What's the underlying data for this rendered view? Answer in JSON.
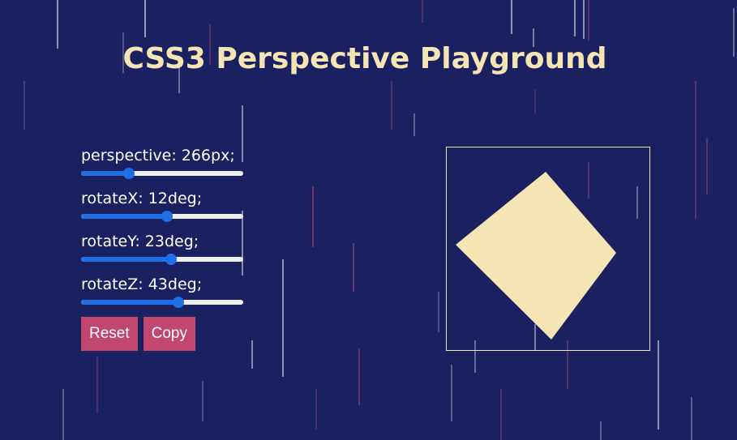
{
  "page": {
    "title": "CSS3 Perspective Playground"
  },
  "controls": [
    {
      "label": "perspective: 266px;",
      "value_fraction": 0.28
    },
    {
      "label": "rotateX: 12deg;",
      "value_fraction": 0.53
    },
    {
      "label": "rotateY: 23deg;",
      "value_fraction": 0.56
    },
    {
      "label": "rotateZ: 43deg;",
      "value_fraction": 0.61
    }
  ],
  "buttons": {
    "reset_label": "Reset",
    "copy_label": "Copy"
  },
  "colors": {
    "background": "#1b2160",
    "title": "#f5e4b4",
    "shape": "#f5e4b4",
    "button": "#c1476e",
    "slider_accent": "#1f6fe8"
  }
}
